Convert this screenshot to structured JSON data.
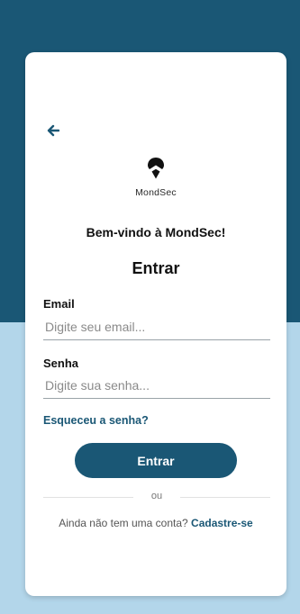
{
  "brand": {
    "name": "MondSec"
  },
  "welcome_text": "Bem-vindo à MondSec!",
  "heading": "Entrar",
  "form": {
    "email": {
      "label": "Email",
      "placeholder": "Digite seu email...",
      "value": ""
    },
    "password": {
      "label": "Senha",
      "placeholder": "Digite sua senha...",
      "value": ""
    }
  },
  "forgot_password_label": "Esqueceu a senha?",
  "submit_label": "Entrar",
  "divider_text": "ou",
  "signup": {
    "prompt": "Ainda não tem uma conta?",
    "link_label": "Cadastre-se"
  },
  "icons": {
    "back": "arrow-left-icon",
    "logo": "location-pin-logo-icon"
  },
  "colors": {
    "primary": "#1a5775",
    "background_top": "#1a5775",
    "background_bottom": "#b3d6ea",
    "card": "#ffffff"
  }
}
